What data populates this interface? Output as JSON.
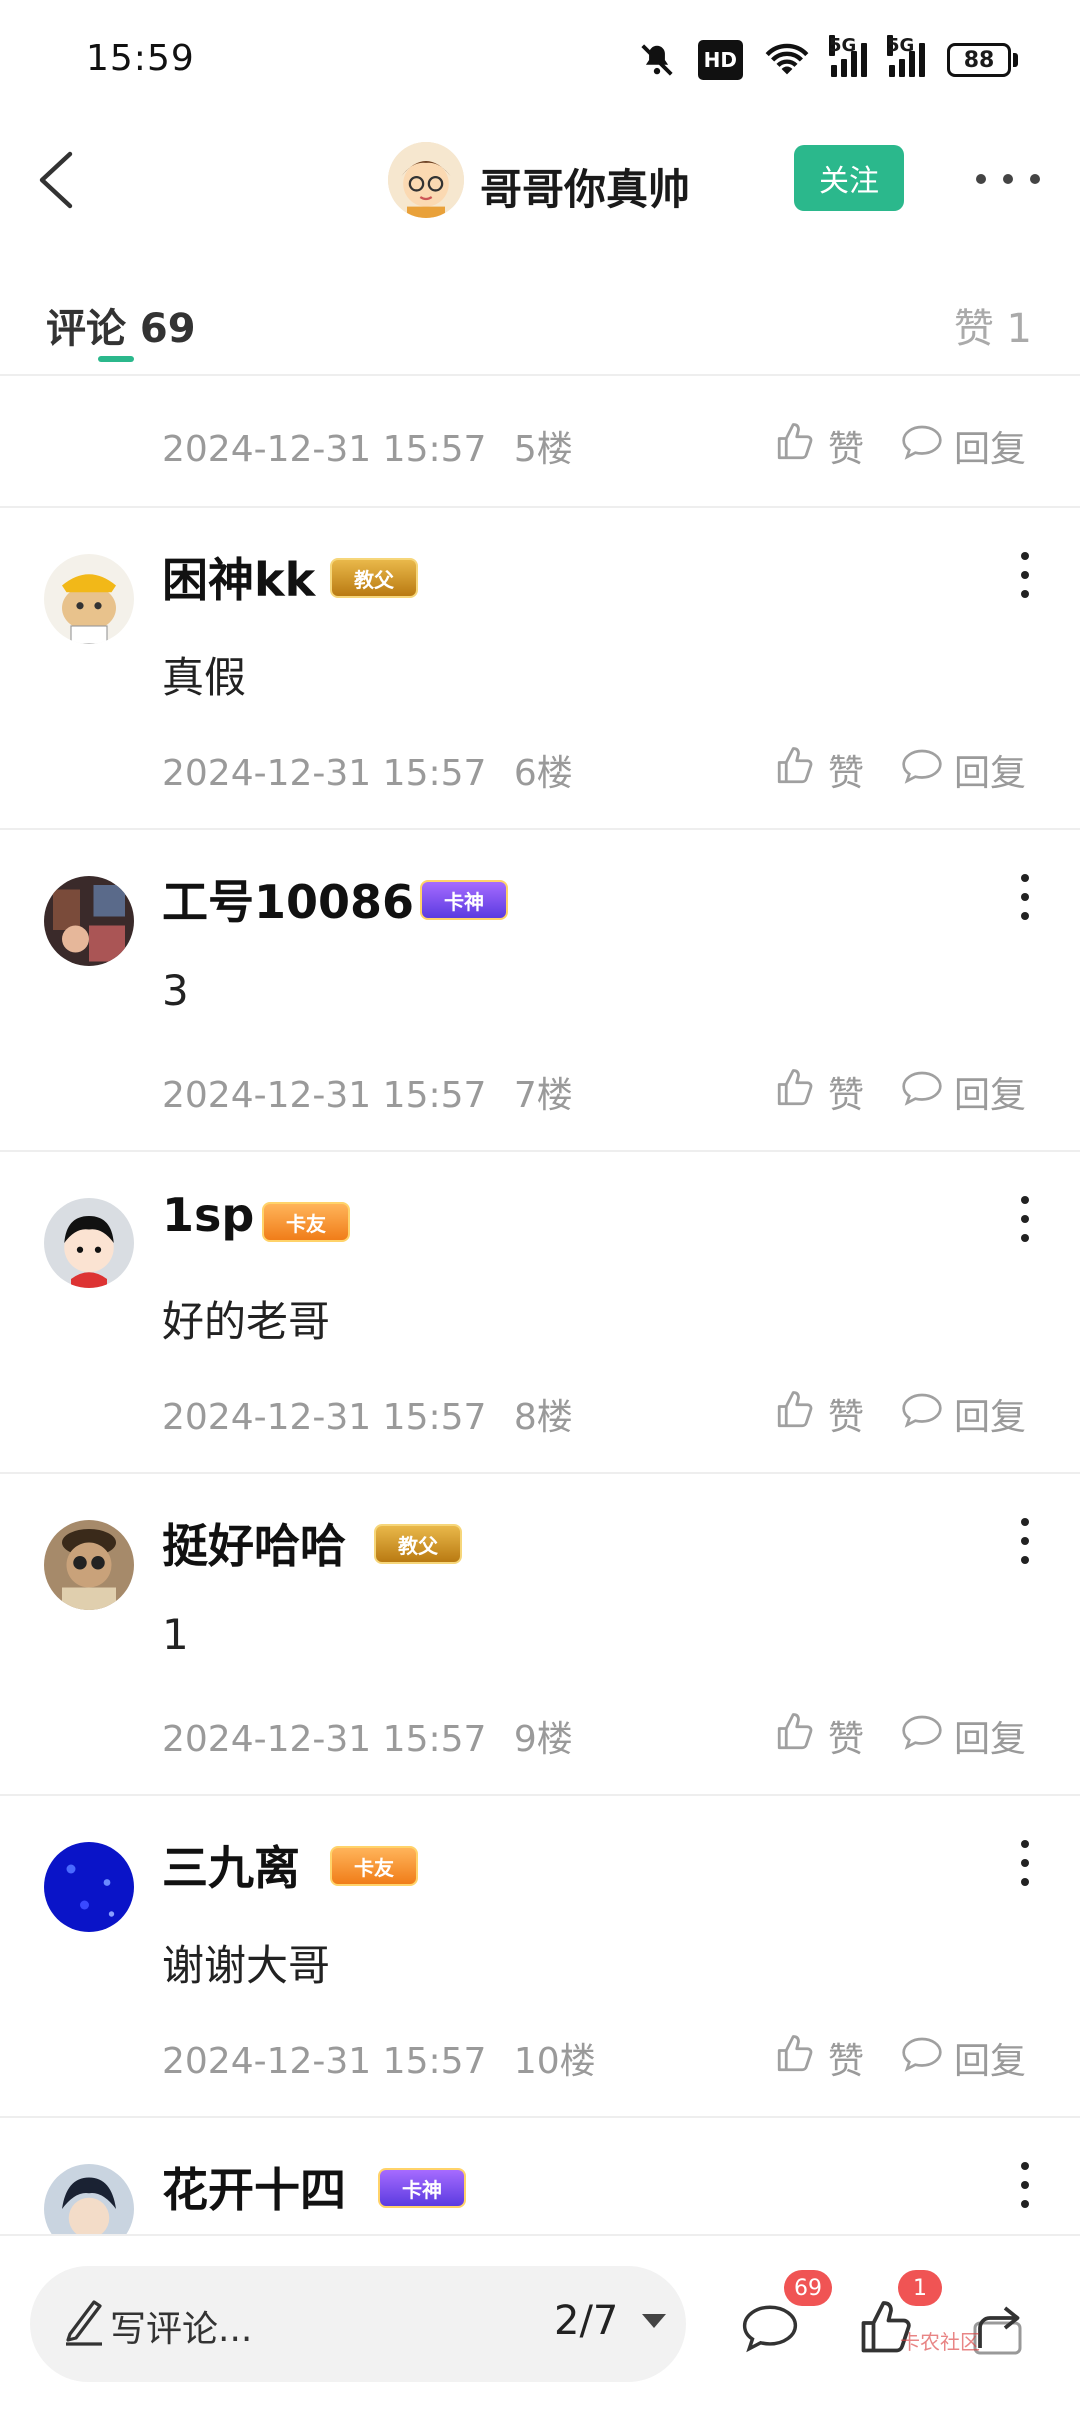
{
  "status_bar": {
    "time": "15:59",
    "hd_label": "HD",
    "network1": "5G",
    "network2": "5G",
    "battery": "88"
  },
  "header": {
    "title": "哥哥你真帅",
    "follow_label": "关注"
  },
  "tabs": {
    "comments_label": "评论 69",
    "likes_label": "赞 1"
  },
  "partial_row": {
    "date": "2024-12-31 15:57",
    "floor": "5楼",
    "like_label": "赞",
    "reply_label": "回复"
  },
  "comments": [
    {
      "name": "困神kk",
      "badge": "教父",
      "text": "真假",
      "date": "2024-12-31 15:57",
      "floor": "6楼",
      "like_label": "赞",
      "reply_label": "回复"
    },
    {
      "name": "工号10086",
      "badge": "卡神",
      "text": "3",
      "date": "2024-12-31 15:57",
      "floor": "7楼",
      "like_label": "赞",
      "reply_label": "回复"
    },
    {
      "name": "1sp",
      "badge": "卡友",
      "text": "好的老哥",
      "date": "2024-12-31 15:57",
      "floor": "8楼",
      "like_label": "赞",
      "reply_label": "回复"
    },
    {
      "name": "挺好哈哈",
      "badge": "教父",
      "text": "1",
      "date": "2024-12-31 15:57",
      "floor": "9楼",
      "like_label": "赞",
      "reply_label": "回复"
    },
    {
      "name": "三九离",
      "badge": "卡友",
      "text": "谢谢大哥",
      "date": "2024-12-31 15:57",
      "floor": "10楼",
      "like_label": "赞",
      "reply_label": "回复"
    },
    {
      "name": "花开十四",
      "badge": "卡神"
    }
  ],
  "bottom_bar": {
    "input_placeholder": "写评论...",
    "page_indicator": "2/7",
    "comment_count": "69",
    "like_count": "1",
    "watermark": "卡农社区"
  },
  "colors": {
    "accent": "#2bb88c",
    "badge_red": "#f05454",
    "meta_gray": "#9a9a9a"
  },
  "icons": [
    "back-icon",
    "more-icon",
    "thumb-up-icon",
    "reply-bubble-icon",
    "pen-icon",
    "share-icon",
    "mute-icon",
    "wifi-icon",
    "signal-icon",
    "battery-icon"
  ]
}
